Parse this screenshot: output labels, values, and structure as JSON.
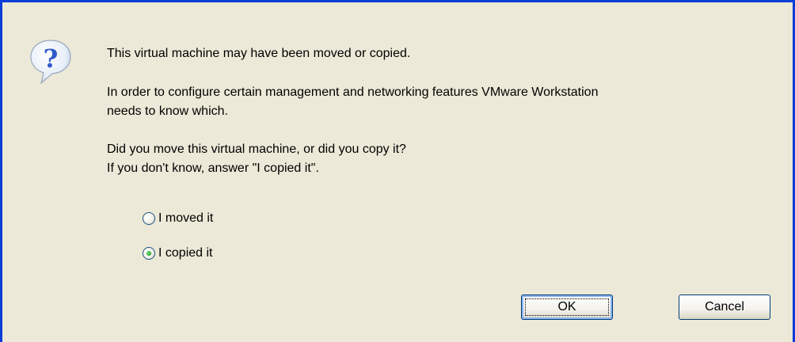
{
  "dialog": {
    "icon": "question-balloon-icon",
    "message_title": "This virtual machine may have been moved or copied.",
    "message_line1": "In order to configure certain management and networking features VMware Workstation",
    "message_line2": "needs to know which.",
    "question_line1": "Did you move this virtual machine, or did you copy it?",
    "question_line2": "If you don't know, answer \"I copied it\".",
    "options": [
      {
        "label": "I moved it",
        "checked": false
      },
      {
        "label": "I copied it",
        "checked": true
      }
    ],
    "buttons": {
      "ok_label": "OK",
      "cancel_label": "Cancel"
    }
  },
  "colors": {
    "frame": "#0A3ED6",
    "background": "#ECE9D8",
    "icon_fill": "#2F59C8"
  }
}
